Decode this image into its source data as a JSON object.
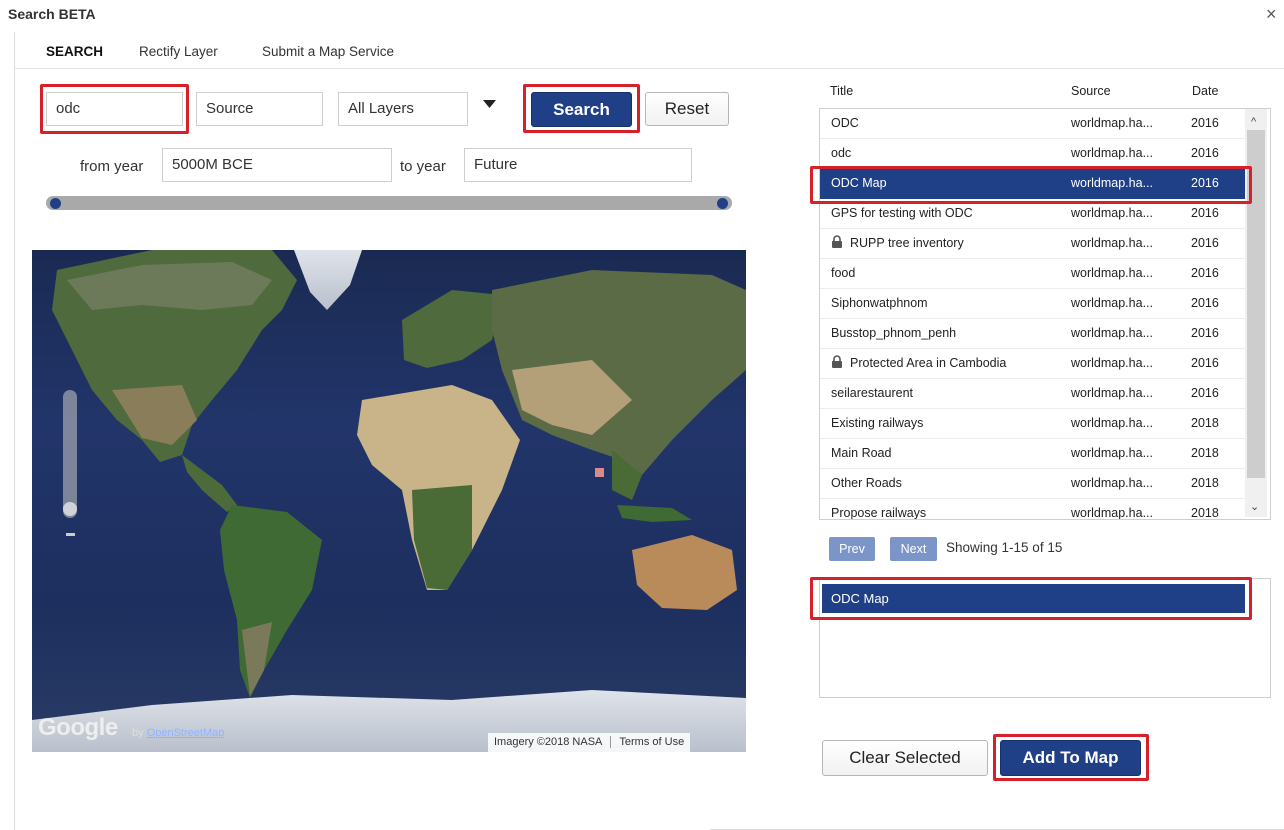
{
  "window": {
    "title": "Search BETA",
    "close_glyph": "×"
  },
  "tabs": [
    {
      "label": "SEARCH",
      "active": true
    },
    {
      "label": "Rectify Layer",
      "active": false
    },
    {
      "label": "Submit a Map Service",
      "active": false
    }
  ],
  "search": {
    "query_value": "odc",
    "source_value": "Source",
    "layers_value": "All Layers",
    "search_label": "Search",
    "reset_label": "Reset",
    "from_year_label": "from year",
    "from_year_value": "5000M BCE",
    "to_year_label": "to year",
    "to_year_value": "Future"
  },
  "map": {
    "google_logo": "Google",
    "by_label": "by",
    "osm_link": "OpenStreetMap",
    "imagery": "Imagery ©2018 NASA",
    "terms": "Terms of Use"
  },
  "results": {
    "columns": {
      "title": "Title",
      "source": "Source",
      "date": "Date"
    },
    "rows": [
      {
        "title": "ODC",
        "source": "worldmap.ha...",
        "date": "2016",
        "locked": false,
        "selected": false
      },
      {
        "title": "odc",
        "source": "worldmap.ha...",
        "date": "2016",
        "locked": false,
        "selected": false
      },
      {
        "title": "ODC Map",
        "source": "worldmap.ha...",
        "date": "2016",
        "locked": false,
        "selected": true
      },
      {
        "title": "GPS for testing with ODC",
        "source": "worldmap.ha...",
        "date": "2016",
        "locked": false,
        "selected": false
      },
      {
        "title": "RUPP tree inventory",
        "source": "worldmap.ha...",
        "date": "2016",
        "locked": true,
        "selected": false
      },
      {
        "title": "food",
        "source": "worldmap.ha...",
        "date": "2016",
        "locked": false,
        "selected": false
      },
      {
        "title": "Siphonwatphnom",
        "source": "worldmap.ha...",
        "date": "2016",
        "locked": false,
        "selected": false
      },
      {
        "title": "Busstop_phnom_penh",
        "source": "worldmap.ha...",
        "date": "2016",
        "locked": false,
        "selected": false
      },
      {
        "title": "Protected Area in Cambodia",
        "source": "worldmap.ha...",
        "date": "2016",
        "locked": true,
        "selected": false
      },
      {
        "title": "seilarestaurent",
        "source": "worldmap.ha...",
        "date": "2016",
        "locked": false,
        "selected": false
      },
      {
        "title": "Existing railways",
        "source": "worldmap.ha...",
        "date": "2018",
        "locked": false,
        "selected": false
      },
      {
        "title": "Main Road",
        "source": "worldmap.ha...",
        "date": "2018",
        "locked": false,
        "selected": false
      },
      {
        "title": "Other Roads",
        "source": "worldmap.ha...",
        "date": "2018",
        "locked": false,
        "selected": false
      },
      {
        "title": "Propose railways",
        "source": "worldmap.ha...",
        "date": "2018",
        "locked": false,
        "selected": false
      }
    ]
  },
  "pagination": {
    "prev": "Prev",
    "next": "Next",
    "showing": "Showing 1-15 of 15"
  },
  "selected": {
    "items": [
      "ODC Map"
    ]
  },
  "actions": {
    "clear_label": "Clear Selected",
    "add_label": "Add To Map"
  },
  "colors": {
    "accent": "#1f3f86",
    "highlight": "#d6202a",
    "pager": "#7b95c8"
  }
}
